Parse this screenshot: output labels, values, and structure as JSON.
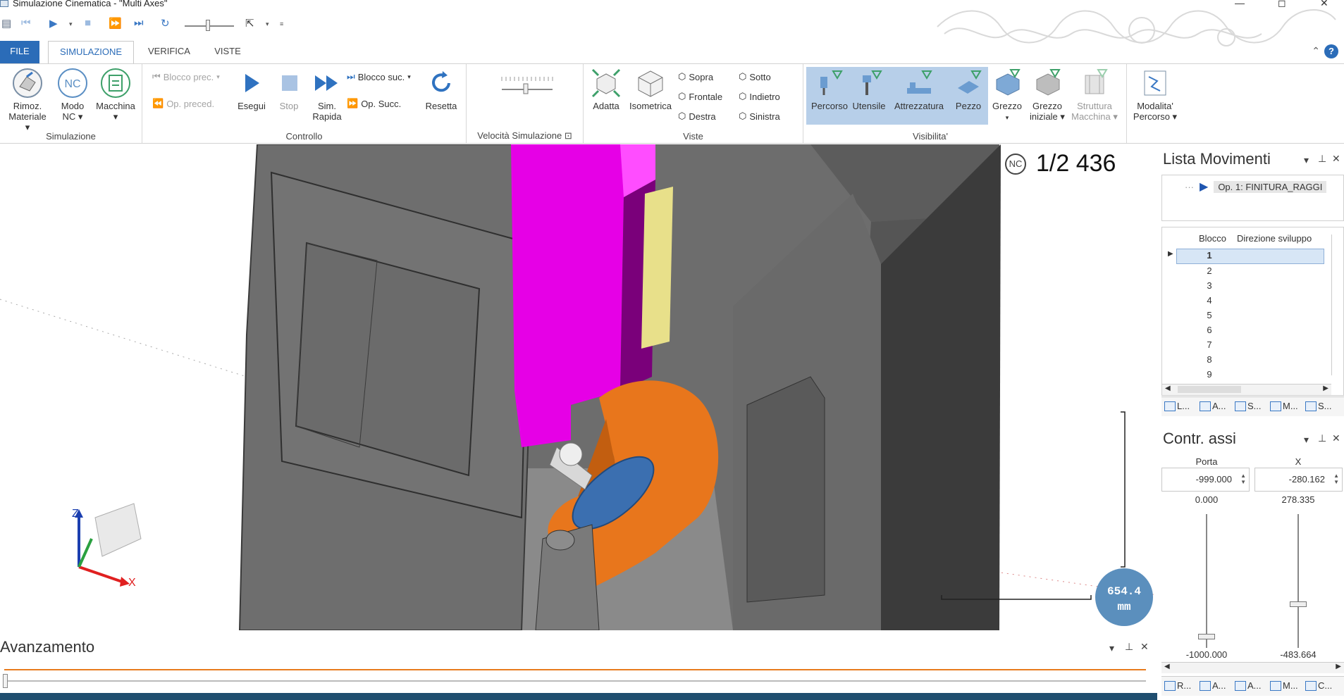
{
  "window": {
    "title": "Simulazione Cinematica - \"Multi Axes\"",
    "controls": [
      "—",
      "◻",
      "✕"
    ]
  },
  "tabs": {
    "file": "FILE",
    "simulazione": "SIMULAZIONE",
    "verifica": "VERIFICA",
    "viste": "VISTE"
  },
  "ribbon": {
    "simulazione": {
      "label": "Simulazione",
      "rimoz": "Rimoz. Materiale ▾",
      "modo": "Modo NC ▾",
      "macchina": "Macchina ▾"
    },
    "controllo": {
      "label": "Controllo",
      "blocco_prec": "Blocco prec.",
      "op_preced": "Op. preced.",
      "esegui": "Esegui",
      "stop": "Stop",
      "sim_rapida": "Sim. Rapida",
      "blocco_suc": "Blocco suc.",
      "op_succ": "Op. Succ.",
      "resetta": "Resetta"
    },
    "velocita": {
      "label": "Velocità Simulazione",
      "value": 0.5
    },
    "viste": {
      "label": "Viste",
      "adatta": "Adatta",
      "isometrica": "Isometrica",
      "sopra": "Sopra",
      "frontale": "Frontale",
      "destra": "Destra",
      "sotto": "Sotto",
      "indietro": "Indietro",
      "sinistra": "Sinistra"
    },
    "visibilita": {
      "label": "Visibilita'",
      "percorso": "Percorso",
      "utensile": "Utensile",
      "attrezzatura": "Attrezzatura",
      "pezzo": "Pezzo",
      "grezzo": "Grezzo",
      "grezzo_iniziale": "Grezzo iniziale",
      "struttura": "Struttura Macchina",
      "modalita": "Modalita' Percorso"
    }
  },
  "viewport": {
    "nc_badge": "NC",
    "counter": "1/2 436",
    "scale": "654.4",
    "scale_unit": "mm",
    "axes": {
      "z": "Z",
      "x": "X"
    }
  },
  "lista_movimenti": {
    "title": "Lista Movimenti",
    "op": "Op. 1: FINITURA_RAGGI",
    "col_blocco": "Blocco",
    "col_direzione": "Direzione sviluppo",
    "rows": [
      "1",
      "2",
      "3",
      "4",
      "5",
      "6",
      "7",
      "8",
      "9"
    ],
    "tabs": [
      "L...",
      "A...",
      "S...",
      "M...",
      "S..."
    ]
  },
  "contr_assi": {
    "title": "Contr. assi",
    "porta": {
      "label": "Porta",
      "value": "-999.000",
      "min": "0.000",
      "bottom": "-1000.000"
    },
    "x": {
      "label": "X",
      "value": "-280.162",
      "min": "278.335",
      "bottom": "-483.664"
    },
    "tabs": [
      "R...",
      "A...",
      "A...",
      "M...",
      "C..."
    ]
  },
  "avanzamento": {
    "title": "Avanzamento",
    "progress": 0.0
  },
  "colors": {
    "accent": "#2b6cb8",
    "spindle": "#e600e6",
    "table": "#e8761c",
    "fixture": "#3b6fb0",
    "machine": "#6a6a6a",
    "progress": "#e87b1d"
  }
}
